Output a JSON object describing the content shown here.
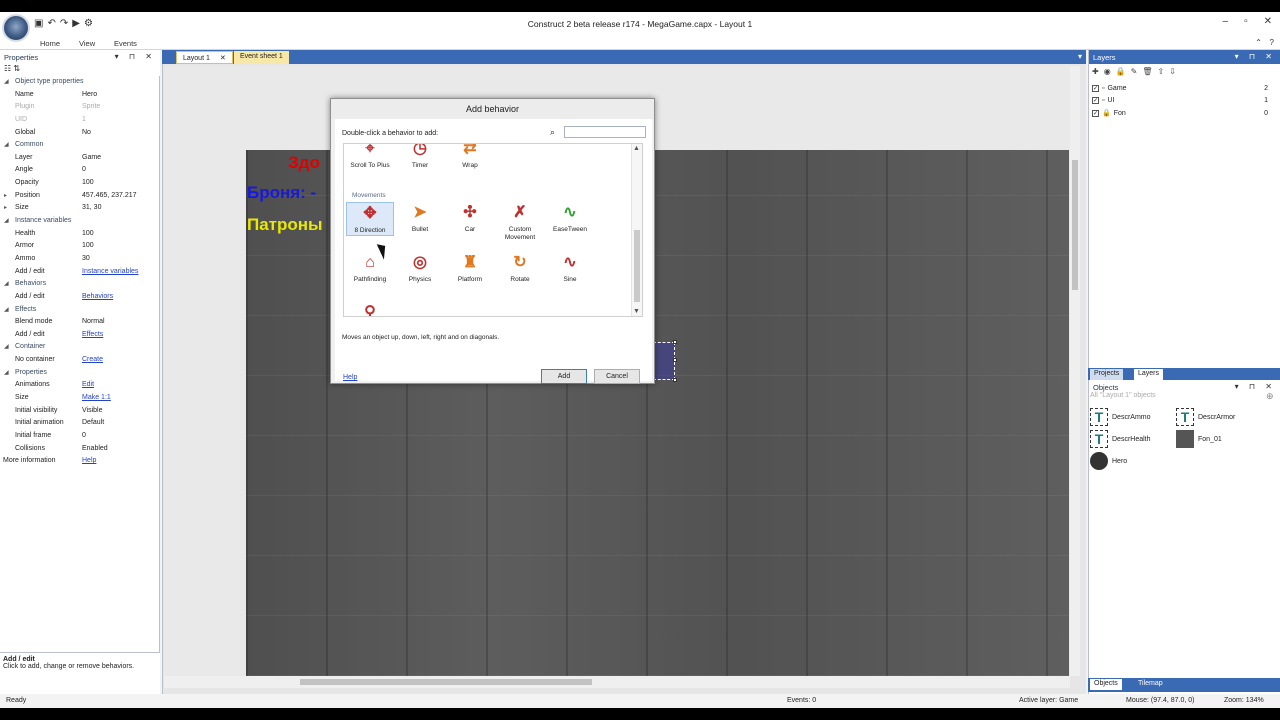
{
  "window": {
    "title": "Construct 2 beta release r174 - MegaGame.capx - Layout 1"
  },
  "ribbon": {
    "home": "Home",
    "view": "View",
    "events": "Events"
  },
  "properties_panel": {
    "title": "Properties",
    "rows": [
      {
        "type": "sec",
        "k": "Object type properties"
      },
      {
        "k": "Name",
        "v": "Hero"
      },
      {
        "k": "Plugin",
        "v": "Sprite",
        "gray": true
      },
      {
        "k": "UID",
        "v": "1",
        "gray": true
      },
      {
        "k": "Global",
        "v": "No"
      },
      {
        "type": "sec",
        "k": "Common"
      },
      {
        "k": "Layer",
        "v": "Game"
      },
      {
        "k": "Angle",
        "v": "0"
      },
      {
        "k": "Opacity",
        "v": "100"
      },
      {
        "k": "Position",
        "v": "457.465, 237.217",
        "exp": true
      },
      {
        "k": "Size",
        "v": "31, 30",
        "exp": true
      },
      {
        "type": "sec",
        "k": "Instance variables"
      },
      {
        "k": "Health",
        "v": "100"
      },
      {
        "k": "Armor",
        "v": "100"
      },
      {
        "k": "Ammo",
        "v": "30"
      },
      {
        "k": "Add / edit",
        "v": "Instance variables",
        "link": true
      },
      {
        "type": "sec",
        "k": "Behaviors"
      },
      {
        "k": "Add / edit",
        "v": "Behaviors",
        "link": true
      },
      {
        "type": "sec",
        "k": "Effects"
      },
      {
        "k": "Blend mode",
        "v": "Normal"
      },
      {
        "k": "Add / edit",
        "v": "Effects",
        "link": true
      },
      {
        "type": "sec",
        "k": "Container"
      },
      {
        "k": "No container",
        "v": "Create",
        "link": true
      },
      {
        "type": "sec",
        "k": "Properties"
      },
      {
        "k": "Animations",
        "v": "Edit",
        "link": true
      },
      {
        "k": "Size",
        "v": "Make 1:1",
        "link": true
      },
      {
        "k": "Initial visibility",
        "v": "Visible"
      },
      {
        "k": "Initial animation",
        "v": "Default"
      },
      {
        "k": "Initial frame",
        "v": "0"
      },
      {
        "k": "Collisions",
        "v": "Enabled"
      },
      {
        "k": "More information",
        "v": "Help",
        "link": true,
        "flush": true
      }
    ],
    "help_title": "Add / edit",
    "help_text": "Click to add, change or remove behaviors."
  },
  "tabs": {
    "layout": "Layout 1",
    "events": "Event sheet 1"
  },
  "canvas": {
    "hud_line1": "Здо",
    "hud_line2": "Броня: -",
    "hud_line3": "Патроны"
  },
  "dialog": {
    "title": "Add behavior",
    "label": "Double-click a behavior to add:",
    "search_value": "",
    "category": "Movements",
    "items_top": [
      "Scroll To Plus",
      "Timer",
      "Wrap"
    ],
    "items_row1": [
      "8 Direction",
      "Bullet",
      "Car",
      "Custom Movement",
      "EaseTween"
    ],
    "items_row2": [
      "Pathfinding",
      "Physics",
      "Platform",
      "Rotate",
      "Sine"
    ],
    "description": "Moves an object up, down, left, right and on diagonals.",
    "help": "Help",
    "add": "Add",
    "cancel": "Cancel"
  },
  "layers_panel": {
    "title": "Layers",
    "layers": [
      {
        "name": "Game",
        "count": "2"
      },
      {
        "name": "UI",
        "count": "1"
      },
      {
        "name": "Fon",
        "count": "0"
      }
    ]
  },
  "panel_tabs": {
    "projects": "Projects",
    "layers": "Layers"
  },
  "objects_panel": {
    "title": "Objects",
    "filter": "All \"Layout 1\" objects",
    "items": [
      "DescrAmmo",
      "DescrArmor",
      "DescrHealth",
      "Fon_01",
      "Hero"
    ]
  },
  "bottom_tabs": {
    "objects": "Objects",
    "tilemap": "Tilemap"
  },
  "status": {
    "ready": "Ready",
    "events": "Events: 0",
    "active_layer": "Active layer: Game",
    "mouse": "Mouse: (97.4, 87.0, 0)",
    "zoom": "Zoom: 134%"
  },
  "colors": {
    "accent": "#3a6ab4",
    "hud_red": "#e00000",
    "hud_blue": "#1818e0",
    "hud_yellow": "#e8e800"
  }
}
